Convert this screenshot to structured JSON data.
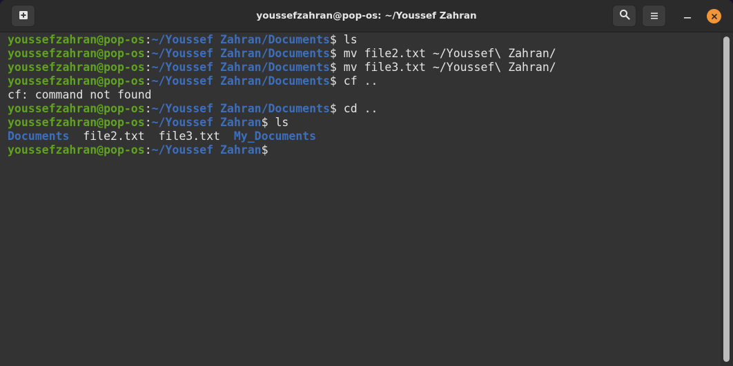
{
  "window": {
    "title": "youssefzahran@pop-os: ~/Youssef Zahran"
  },
  "titlebar": {
    "new_tab_icon": "new-tab-icon",
    "search_icon": "search-icon",
    "menu_icon": "hamburger-menu-icon",
    "minimize_icon": "minimize-icon",
    "close_icon": "close-icon",
    "close_color": "#f29538"
  },
  "colors": {
    "background": "#333333",
    "user_host": "#5fa320",
    "path": "#3d6fbf",
    "text": "#e5e5e5"
  },
  "terminal": {
    "lines": [
      {
        "type": "prompt",
        "user": "youssefzahran@pop-os",
        "sep": ":",
        "path": "~/Youssef Zahran/Documents",
        "symbol": "$",
        "command": " ls"
      },
      {
        "type": "prompt",
        "user": "youssefzahran@pop-os",
        "sep": ":",
        "path": "~/Youssef Zahran/Documents",
        "symbol": "$",
        "command": " mv file2.txt ~/Youssef\\ Zahran/"
      },
      {
        "type": "prompt",
        "user": "youssefzahran@pop-os",
        "sep": ":",
        "path": "~/Youssef Zahran/Documents",
        "symbol": "$",
        "command": " mv file3.txt ~/Youssef\\ Zahran/"
      },
      {
        "type": "prompt",
        "user": "youssefzahran@pop-os",
        "sep": ":",
        "path": "~/Youssef Zahran/Documents",
        "symbol": "$",
        "command": " cf .."
      },
      {
        "type": "output",
        "text": "cf: command not found"
      },
      {
        "type": "prompt",
        "user": "youssefzahran@pop-os",
        "sep": ":",
        "path": "~/Youssef Zahran/Documents",
        "symbol": "$",
        "command": " cd .."
      },
      {
        "type": "prompt",
        "user": "youssefzahran@pop-os",
        "sep": ":",
        "path": "~/Youssef Zahran",
        "symbol": "$",
        "command": " ls"
      },
      {
        "type": "listing",
        "entries": [
          {
            "name": "Documents",
            "kind": "dir",
            "sep": "  "
          },
          {
            "name": "file2.txt",
            "kind": "file",
            "sep": "  "
          },
          {
            "name": "file3.txt",
            "kind": "file",
            "sep": "  "
          },
          {
            "name": "My_Documents",
            "kind": "dir",
            "sep": ""
          }
        ]
      },
      {
        "type": "prompt",
        "user": "youssefzahran@pop-os",
        "sep": ":",
        "path": "~/Youssef Zahran",
        "symbol": "$",
        "command": ""
      }
    ]
  }
}
